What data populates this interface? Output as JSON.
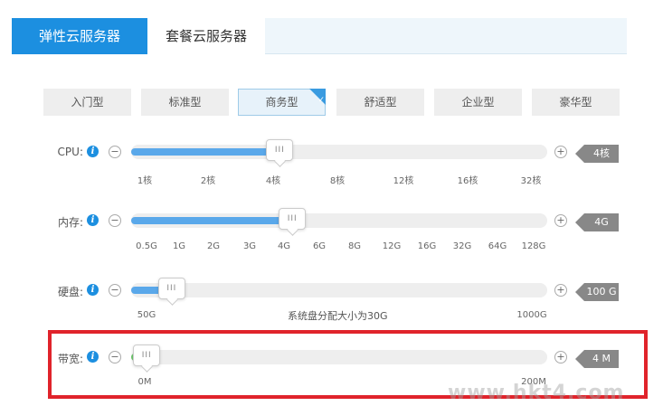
{
  "tabs": [
    {
      "label": "弹性云服务器"
    },
    {
      "label": "套餐云服务器"
    }
  ],
  "plans": [
    {
      "label": "入门型"
    },
    {
      "label": "标准型"
    },
    {
      "label": "商务型"
    },
    {
      "label": "舒适型"
    },
    {
      "label": "企业型"
    },
    {
      "label": "豪华型"
    }
  ],
  "selected_plan": "商务型",
  "colors": {
    "accent": "#1c8fe0",
    "fill": "#5aa8ea",
    "bandwidth_fill": "#6cc86c",
    "highlight": "#e0232b"
  },
  "info_icon": "i",
  "minus": "−",
  "plus": "+",
  "handle_grip": "III",
  "cpu": {
    "label": "CPU:",
    "value": "4核",
    "ticks": [
      "1核",
      "2核",
      "4核",
      "8核",
      "12核",
      "16核",
      "32核"
    ],
    "level": 0.34
  },
  "memory": {
    "label": "内存:",
    "value": "4G",
    "ticks": [
      "0.5G",
      "1G",
      "2G",
      "3G",
      "4G",
      "6G",
      "8G",
      "12G",
      "16G",
      "32G",
      "64G",
      "128G"
    ],
    "level": 0.37
  },
  "disk": {
    "label": "硬盘:",
    "value": "100 G",
    "ticks": [
      "50G",
      "1000G"
    ],
    "note": "系统盘分配大小为30G",
    "level": 0.08
  },
  "bandwidth": {
    "label": "带宽:",
    "value": "4 M",
    "ticks": [
      "0M",
      "200M"
    ],
    "level": 0.02
  },
  "watermark": "www.hkt4.com"
}
